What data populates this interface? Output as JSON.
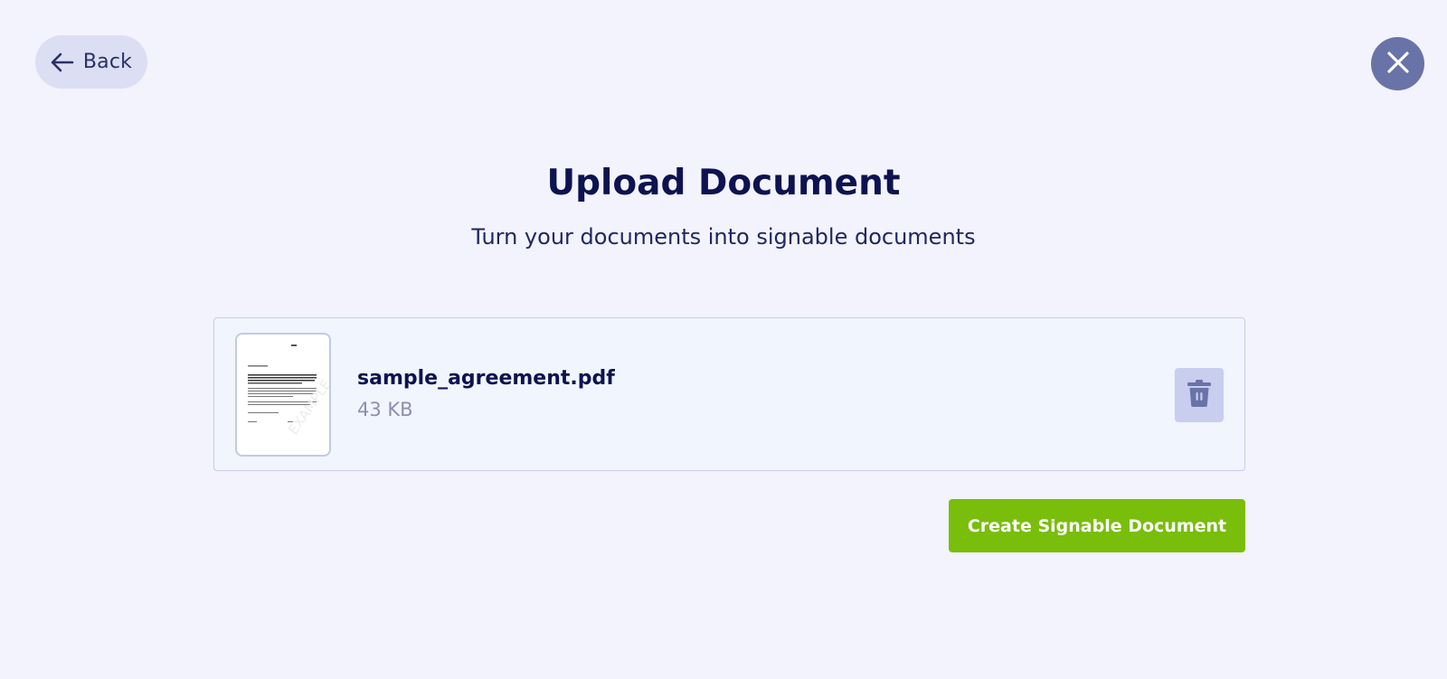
{
  "header": {
    "back_label": "Back",
    "back_icon": "arrow-left-icon",
    "close_icon": "close-icon"
  },
  "main": {
    "title": "Upload Document",
    "subtitle": "Turn your documents into signable documents"
  },
  "file": {
    "name": "sample_agreement.pdf",
    "size": "43 KB",
    "thumbnail_icon": "document-preview",
    "delete_icon": "trash-icon"
  },
  "actions": {
    "create_label": "Create Signable Document"
  },
  "colors": {
    "background": "#f2f3fc",
    "primary_text": "#0d1350",
    "back_button_bg": "#dcdff3",
    "close_button_bg": "#6a73a8",
    "card_bg": "#f0f5fe",
    "card_border": "#c9cde6",
    "delete_button_bg": "#c9cdee",
    "delete_icon": "#6a73a8",
    "create_button_bg": "#78be0a",
    "muted_text": "#8a90b0"
  }
}
